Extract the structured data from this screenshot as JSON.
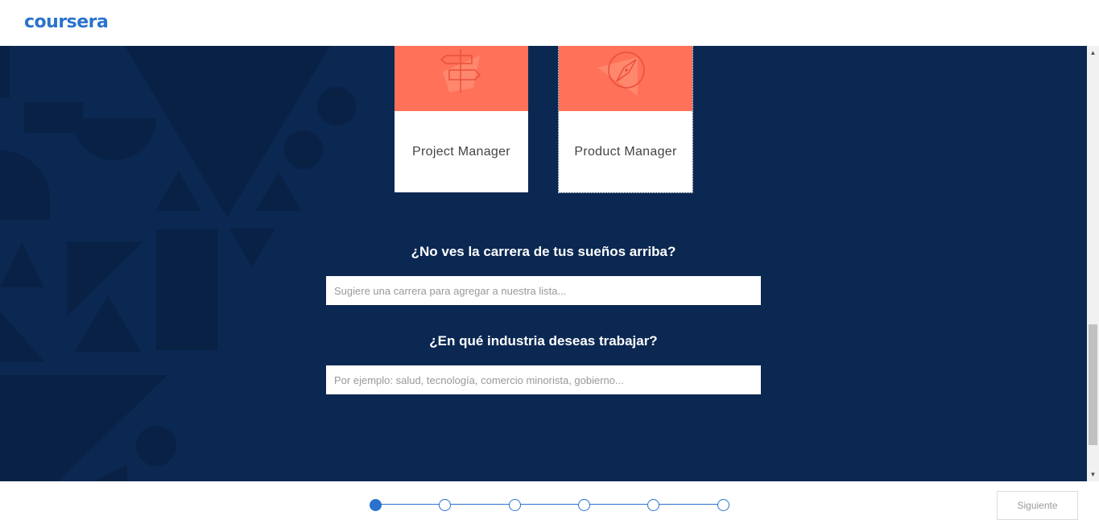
{
  "header": {
    "logo_text": "coursera"
  },
  "cards": [
    {
      "label": "Project Manager",
      "icon": "signpost-icon",
      "selected": false
    },
    {
      "label": "Product Manager",
      "icon": "compass-icon",
      "selected": true
    }
  ],
  "career_question": {
    "title": "¿No ves la carrera de tus sueños arriba?",
    "placeholder": "Sugiere una carrera para agregar a nuestra lista...",
    "value": ""
  },
  "industry_question": {
    "title": "¿En qué industria deseas trabajar?",
    "placeholder": "Por ejemplo: salud, tecnología, comercio minorista, gobierno...",
    "value": ""
  },
  "progress": {
    "total_steps": 6,
    "current_step": 1
  },
  "footer": {
    "next_label": "Siguiente"
  },
  "colors": {
    "brand": "#2a73cc",
    "background": "#0b2852",
    "card_accent": "#ff7158"
  }
}
